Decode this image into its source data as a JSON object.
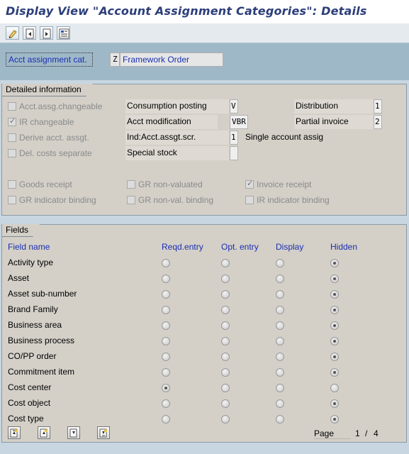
{
  "title": "Display View \"Account Assignment Categories\": Details",
  "toolbar": {
    "icons": [
      "edit-icon",
      "prev-entry-icon",
      "next-entry-icon",
      "details-icon"
    ]
  },
  "header": {
    "key_label": "Acct assignment cat.",
    "key_value": "Z",
    "key_description": "Framework Order"
  },
  "detailed_info": {
    "title": "Detailed information",
    "checkboxes": [
      {
        "label": "Acct.assg.changeable",
        "checked": false
      },
      {
        "label": "IR changeable",
        "checked": true
      },
      {
        "label": "Derive acct. assgt.",
        "checked": false
      },
      {
        "label": "Del. costs separate",
        "checked": false
      }
    ],
    "consumption_posting_label": "Consumption posting",
    "consumption_posting_value": "V",
    "acct_modification_label": "Acct modification",
    "acct_modification_value": "VBR",
    "ind_acct_assgt_label": "Ind:Acct.assgt.scr.",
    "ind_acct_assgt_value": "1",
    "ind_acct_assgt_text": "Single account assig",
    "special_stock_label": "Special stock",
    "special_stock_value": "",
    "distribution_label": "Distribution",
    "distribution_value": "1",
    "partial_invoice_label": "Partial invoice",
    "partial_invoice_value": "2",
    "gr_checkboxes": [
      {
        "label": "Goods receipt",
        "checked": false
      },
      {
        "label": "GR non-valuated",
        "checked": false
      },
      {
        "label": "Invoice receipt",
        "checked": true
      },
      {
        "label": "GR indicator binding",
        "checked": false
      },
      {
        "label": "GR non-val. binding",
        "checked": false
      },
      {
        "label": "IR indicator binding",
        "checked": false
      }
    ]
  },
  "fields": {
    "title": "Fields",
    "columns": [
      "Field name",
      "Reqd.entry",
      "Opt. entry",
      "Display",
      "Hidden"
    ],
    "rows": [
      {
        "name": "Activity type",
        "selected": 3
      },
      {
        "name": "Asset",
        "selected": 3
      },
      {
        "name": "Asset sub-number",
        "selected": 3
      },
      {
        "name": "Brand Family",
        "selected": 3
      },
      {
        "name": "Business area",
        "selected": 3
      },
      {
        "name": "Business process",
        "selected": 3
      },
      {
        "name": "CO/PP order",
        "selected": 3
      },
      {
        "name": "Commitment item",
        "selected": 3
      },
      {
        "name": "Cost center",
        "selected": 0
      },
      {
        "name": "Cost object",
        "selected": 3
      },
      {
        "name": "Cost type",
        "selected": 3
      }
    ],
    "page_label": "Page",
    "page_current": "1",
    "page_sep": "/",
    "page_total": "4",
    "nav_icons": [
      "first-page-icon",
      "prev-page-icon",
      "next-page-icon",
      "last-page-icon"
    ]
  }
}
